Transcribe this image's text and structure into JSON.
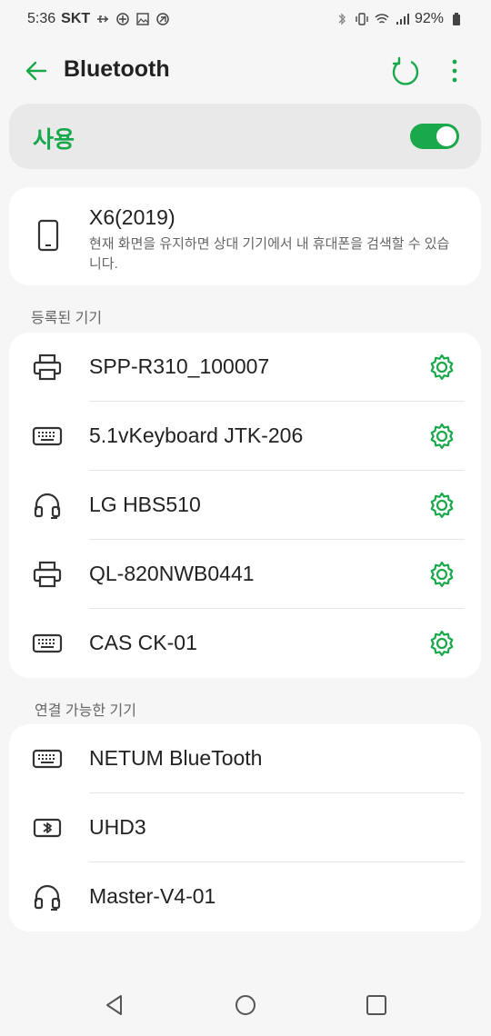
{
  "status_bar": {
    "time": "5:36",
    "carrier": "SKT",
    "battery": "92%",
    "left_icons": [
      "usb-icon",
      "data-saver-icon",
      "gallery-icon",
      "location-icon"
    ],
    "right_icons": [
      "bluetooth-status-icon",
      "vibrate-icon",
      "wifi-icon",
      "signal-icon",
      "battery-icon"
    ]
  },
  "app_bar": {
    "title": "Bluetooth"
  },
  "toggle": {
    "label": "사용",
    "on": true
  },
  "this_device": {
    "name": "X6(2019)",
    "description": "현재 화면을 유지하면 상대 기기에서 내 휴대폰을 검색할 수 있습니다."
  },
  "paired": {
    "header": "등록된 기기",
    "devices": [
      {
        "name": "SPP-R310_100007",
        "icon": "printer-icon"
      },
      {
        "name": "5.1vKeyboard JTK-206",
        "icon": "keyboard-icon"
      },
      {
        "name": "LG HBS510",
        "icon": "headset-icon"
      },
      {
        "name": "QL-820NWB0441",
        "icon": "printer-icon"
      },
      {
        "name": "CAS CK-01",
        "icon": "keyboard-icon"
      }
    ]
  },
  "available": {
    "header": "연결 가능한 기기",
    "devices": [
      {
        "name": "NETUM BlueTooth",
        "icon": "keyboard-icon"
      },
      {
        "name": "UHD3",
        "icon": "bluetooth-device-icon"
      },
      {
        "name": "Master-V4-01",
        "icon": "headset-icon"
      }
    ]
  },
  "colors": {
    "accent": "#19a84a",
    "background": "#f6f6f6",
    "card": "#ffffff"
  }
}
